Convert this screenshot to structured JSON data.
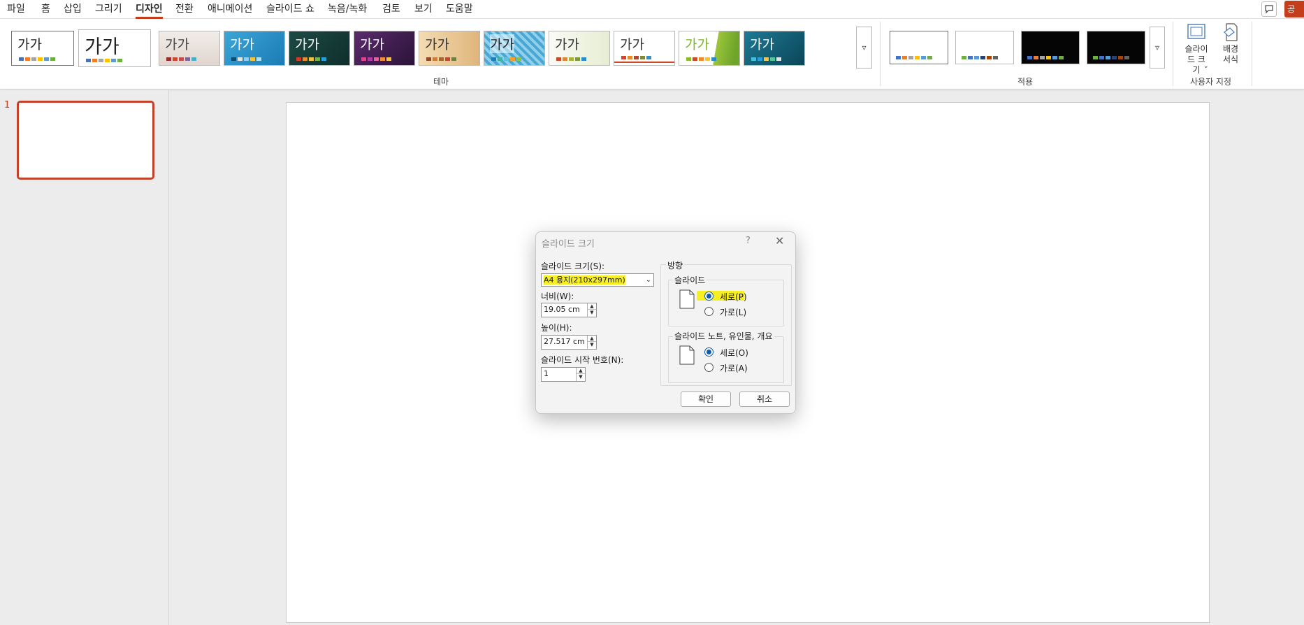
{
  "menu": {
    "tabs": [
      {
        "label": "파일",
        "active": false
      },
      {
        "label": "홈",
        "active": false
      },
      {
        "label": "삽입",
        "active": false
      },
      {
        "label": "그리기",
        "active": false
      },
      {
        "label": "디자인",
        "active": true
      },
      {
        "label": "전환",
        "active": false
      },
      {
        "label": "애니메이션",
        "active": false
      },
      {
        "label": "슬라이드 쇼",
        "active": false
      },
      {
        "label": "녹음/녹화",
        "active": false
      },
      {
        "label": "검토",
        "active": false
      },
      {
        "label": "보기",
        "active": false
      },
      {
        "label": "도움말",
        "active": false
      }
    ],
    "share_label": "공"
  },
  "ribbon": {
    "theme_sample_text": "가가",
    "themes_group_label": "테마",
    "variants_group_label": "적용",
    "customize_group_label": "사용자 지정",
    "slide_size_label": "슬라이드 크기",
    "format_background_label": "배경 서식"
  },
  "thumbnails": {
    "slide_number": "1"
  },
  "dialog": {
    "title": "슬라이드 크기",
    "help": "?",
    "slide_size_label": "슬라이드 크기(S):",
    "slide_size_value": "A4 용지(210x297mm)",
    "width_label": "너비(W):",
    "width_value": "19.05 cm",
    "height_label": "높이(H):",
    "height_value": "27.517 cm",
    "start_number_label": "슬라이드 시작 번호(N):",
    "start_number_value": "1",
    "orientation_label": "방향",
    "slides_group_label": "슬라이드",
    "slides_portrait_label": "세로(P)",
    "slides_landscape_label": "가로(L)",
    "notes_group_label": "슬라이드 노트, 유인물, 개요",
    "notes_portrait_label": "세로(O)",
    "notes_landscape_label": "가로(A)",
    "ok_label": "확인",
    "cancel_label": "취소"
  },
  "colors": {
    "accent": "#c43e1c",
    "highlight": "#f7ef22",
    "radio_selected": "#0b5cad"
  }
}
